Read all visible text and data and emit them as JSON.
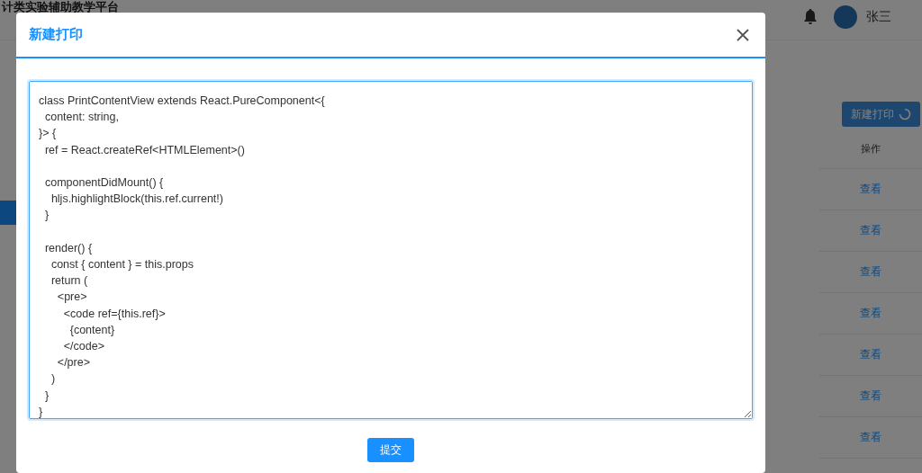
{
  "app_header": {
    "title": "计类实验辅助教学平台",
    "user_name": "张三"
  },
  "toolbar": {
    "new_print_button": {
      "label": "新建打印",
      "loading": true
    }
  },
  "table": {
    "columns": [
      "操作"
    ],
    "rows": [
      {
        "action": "查看"
      },
      {
        "action": "查看"
      },
      {
        "action": "查看"
      },
      {
        "action": "查看"
      },
      {
        "action": "查看"
      },
      {
        "action": "查看"
      },
      {
        "action": "查看"
      }
    ]
  },
  "modal": {
    "title": "新建打印",
    "code_field": {
      "value": "class PrintContentView extends React.PureComponent<{\n  content: string,\n}> {\n  ref = React.createRef<HTMLElement>()\n\n  componentDidMount() {\n    hljs.highlightBlock(this.ref.current!)\n  }\n\n  render() {\n    const { content } = this.props\n    return (\n      <pre>\n        <code ref={this.ref}>\n          {content}\n        </code>\n      </pre>\n    )\n  }\n}"
    },
    "submit_button": "提交"
  }
}
